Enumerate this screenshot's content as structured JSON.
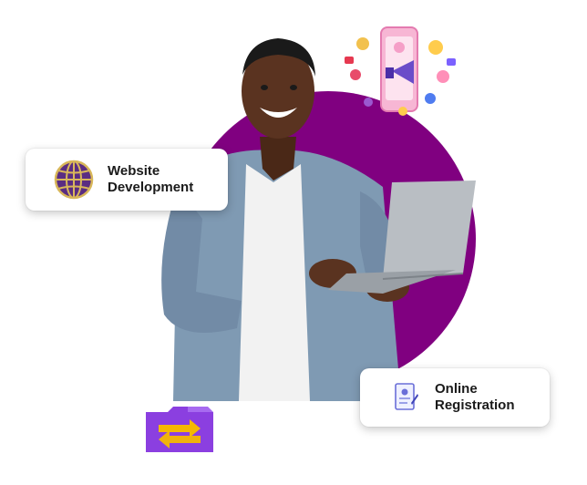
{
  "badges": {
    "website": {
      "line1": "Website",
      "line2": "Development"
    },
    "registration": {
      "line1": "Online",
      "line2": "Registration"
    }
  },
  "icons": {
    "website": "globe-icon",
    "registration": "form-document-icon",
    "transfer": "folder-transfer-icon",
    "social": "social-media-marketing-icon"
  },
  "colors": {
    "accent": "#800080",
    "folder": "#8B3FE0",
    "arrows": "#F5B800",
    "globe": "#5A2D82"
  }
}
